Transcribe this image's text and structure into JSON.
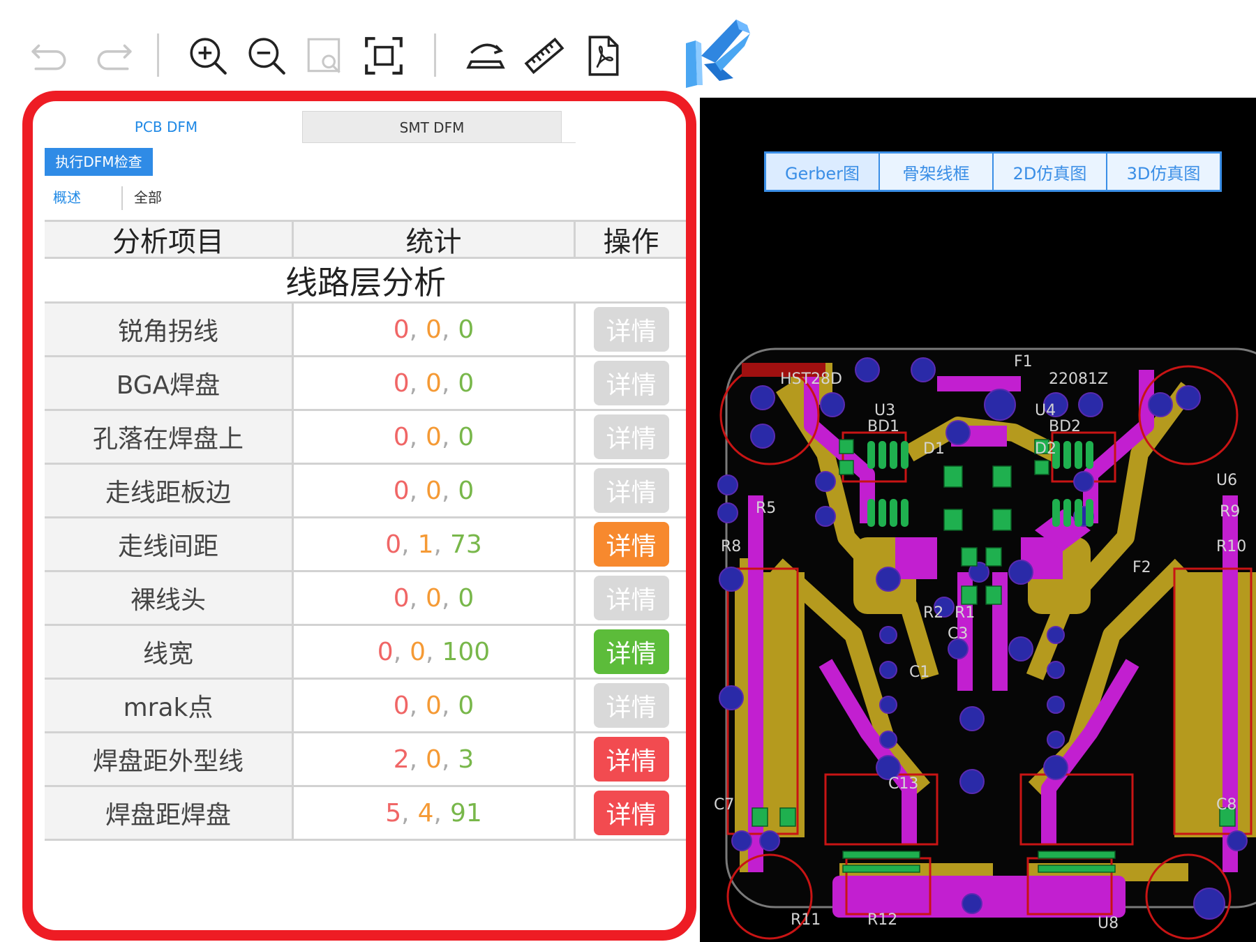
{
  "toolbar": {
    "icons": [
      "undo-icon",
      "redo-icon",
      "zoom-in-icon",
      "zoom-out-icon",
      "zoom-window-icon",
      "fit-screen-icon",
      "flip-board-icon",
      "ruler-icon",
      "pdf-export-icon"
    ],
    "logo": "kingdee-logo-icon"
  },
  "tabs": {
    "pcb": "PCB DFM",
    "smt": "SMT DFM"
  },
  "run_button": "执行DFM检查",
  "sub_tabs": {
    "overview": "概述",
    "all": "全部"
  },
  "table": {
    "headers": {
      "item": "分析项目",
      "stats": "统计",
      "action": "操作"
    },
    "section": "线路层分析",
    "rows": [
      {
        "name": "锐角拐线",
        "values": [
          "0",
          "0",
          "0"
        ],
        "button": "详情",
        "button_color": "#d9d9d9"
      },
      {
        "name": "BGA焊盘",
        "values": [
          "0",
          "0",
          "0"
        ],
        "button": "详情",
        "button_color": "#d9d9d9"
      },
      {
        "name": "孔落在焊盘上",
        "values": [
          "0",
          "0",
          "0"
        ],
        "button": "详情",
        "button_color": "#d9d9d9"
      },
      {
        "name": "走线距板边",
        "values": [
          "0",
          "0",
          "0"
        ],
        "button": "详情",
        "button_color": "#d9d9d9"
      },
      {
        "name": "走线间距",
        "values": [
          "0",
          "1",
          "73"
        ],
        "button": "详情",
        "button_color": "#f7892e"
      },
      {
        "name": "裸线头",
        "values": [
          "0",
          "0",
          "0"
        ],
        "button": "详情",
        "button_color": "#d9d9d9"
      },
      {
        "name": "线宽",
        "values": [
          "0",
          "0",
          "100"
        ],
        "button": "详情",
        "button_color": "#5cbc3a"
      },
      {
        "name": "mrak点",
        "values": [
          "0",
          "0",
          "0"
        ],
        "button": "详情",
        "button_color": "#d9d9d9"
      },
      {
        "name": "焊盘距外型线",
        "values": [
          "2",
          "0",
          "3"
        ],
        "button": "详情",
        "button_color": "#f24b50"
      },
      {
        "name": "焊盘距焊盘",
        "values": [
          "5",
          "4",
          "91"
        ],
        "button": "详情",
        "button_color": "#f24b50"
      }
    ]
  },
  "viewer": {
    "tabs": [
      "Gerber图",
      "骨架线框",
      "2D仿真图",
      "3D仿真图"
    ],
    "active_tab": 0,
    "board_labels": [
      "HST28D",
      "22081Z",
      "F1",
      "U3",
      "U4",
      "BD1",
      "BD2",
      "D1",
      "D2",
      "U6",
      "R5",
      "R8",
      "R9",
      "R10",
      "R2",
      "R1",
      "C3",
      "C1",
      "C13",
      "C7",
      "C8",
      "R11",
      "R12",
      "U8",
      "F2"
    ]
  },
  "colors": {
    "highlight_frame": "#ee1c24",
    "accent": "#1e88e5",
    "pcb_trace": "#b59a1e",
    "pcb_copper": "#c21fd0",
    "pcb_pad": "#2a2aa8",
    "pcb_outline": "#c81414"
  }
}
